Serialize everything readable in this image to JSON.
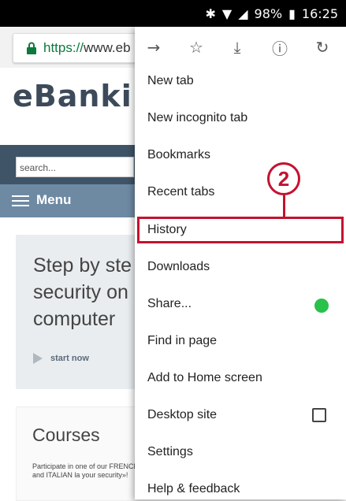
{
  "status": {
    "battery": "98%",
    "time": "16:25"
  },
  "browser": {
    "url_scheme": "https://",
    "url_rest": "www.eb"
  },
  "page": {
    "logo": "eBanki",
    "search_placeholder": "search...",
    "menu_label": "Menu",
    "hero_title": "Step by ste\nsecurity on\ncomputer",
    "start_now": "start now",
    "courses_title": "Courses",
    "courses_text": "Participate in one of our FRENCH and ITALIAN la your security»!"
  },
  "menu": {
    "toolbar": [
      "forward-icon",
      "star-icon",
      "download-icon",
      "info-icon",
      "refresh-icon"
    ],
    "items": [
      "New tab",
      "New incognito tab",
      "Bookmarks",
      "Recent tabs",
      "History",
      "Downloads",
      "Share...",
      "Find in page",
      "Add to Home screen",
      "Desktop site",
      "Settings",
      "Help & feedback"
    ]
  },
  "annotation": {
    "number": "2",
    "color": "#c4122f"
  }
}
